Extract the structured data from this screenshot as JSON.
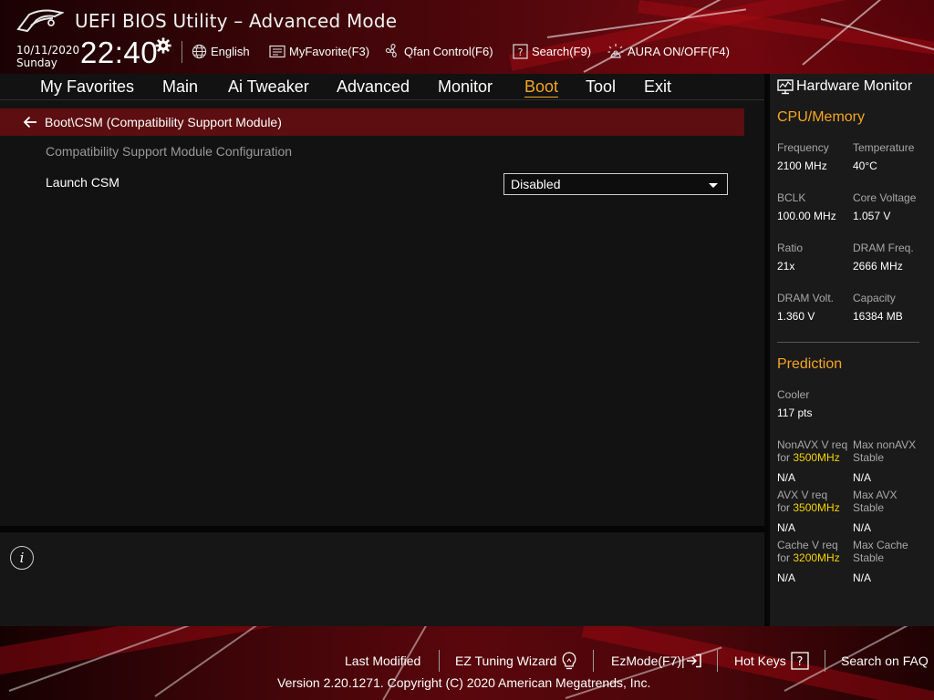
{
  "header": {
    "app_title": "UEFI BIOS Utility – Advanced Mode",
    "date": "10/11/2020",
    "day": "Sunday",
    "time": "22:40",
    "items": [
      {
        "label": "English",
        "icon": "globe-icon"
      },
      {
        "label": "MyFavorite(F3)",
        "icon": "favorite-icon"
      },
      {
        "label": "Qfan Control(F6)",
        "icon": "fan-icon"
      },
      {
        "label": "Search(F9)",
        "icon": "search-help-icon"
      },
      {
        "label": "AURA ON/OFF(F4)",
        "icon": "aura-icon"
      }
    ]
  },
  "nav": {
    "tabs": [
      {
        "label": "My Favorites"
      },
      {
        "label": "Main"
      },
      {
        "label": "Ai Tweaker"
      },
      {
        "label": "Advanced"
      },
      {
        "label": "Monitor"
      },
      {
        "label": "Boot",
        "active": true
      },
      {
        "label": "Tool"
      },
      {
        "label": "Exit"
      }
    ]
  },
  "main": {
    "breadcrumb": "Boot\\CSM (Compatibility Support Module)",
    "section_label": "Compatibility Support Module Configuration",
    "settings": [
      {
        "label": "Launch CSM",
        "value": "Disabled"
      }
    ]
  },
  "hardware_monitor": {
    "title": "Hardware Monitor",
    "cpu_memory": {
      "heading": "CPU/Memory",
      "items": [
        {
          "label": "Frequency",
          "value": "2100 MHz"
        },
        {
          "label": "Temperature",
          "value": "40°C"
        },
        {
          "label": "BCLK",
          "value": "100.00 MHz"
        },
        {
          "label": "Core Voltage",
          "value": "1.057 V"
        },
        {
          "label": "Ratio",
          "value": "21x"
        },
        {
          "label": "DRAM Freq.",
          "value": "2666 MHz"
        },
        {
          "label": "DRAM Volt.",
          "value": "1.360 V"
        },
        {
          "label": "Capacity",
          "value": "16384 MB"
        }
      ]
    },
    "prediction": {
      "heading": "Prediction",
      "cooler_label": "Cooler",
      "cooler_value": "117 pts",
      "rows": [
        {
          "left_label": "NonAVX V req",
          "left_for": "for",
          "left_freq": "3500MHz",
          "left_value": "N/A",
          "right_label_1": "Max nonAVX",
          "right_label_2": "Stable",
          "right_value": "N/A"
        },
        {
          "left_label": "AVX V req",
          "left_for": "for",
          "left_freq": "3500MHz",
          "left_value": "N/A",
          "right_label_1": "Max AVX",
          "right_label_2": "Stable",
          "right_value": "N/A"
        },
        {
          "left_label": "Cache V req",
          "left_for": "for",
          "left_freq": "3200MHz",
          "left_value": "N/A",
          "right_label_1": "Max Cache",
          "right_label_2": "Stable",
          "right_value": "N/A"
        }
      ]
    }
  },
  "footer": {
    "items": [
      {
        "label": "Last Modified"
      },
      {
        "label": "EZ Tuning Wizard"
      },
      {
        "label": "EzMode(F7)|"
      },
      {
        "label": "Hot Keys"
      },
      {
        "label": "Search on FAQ"
      }
    ],
    "copyright": "Version 2.20.1271. Copyright (C) 2020 American Megatrends, Inc."
  },
  "colors": {
    "accent": "#f5a623",
    "highlight": "#f5d400",
    "breadcrumb_bg": "#5c0e10"
  }
}
